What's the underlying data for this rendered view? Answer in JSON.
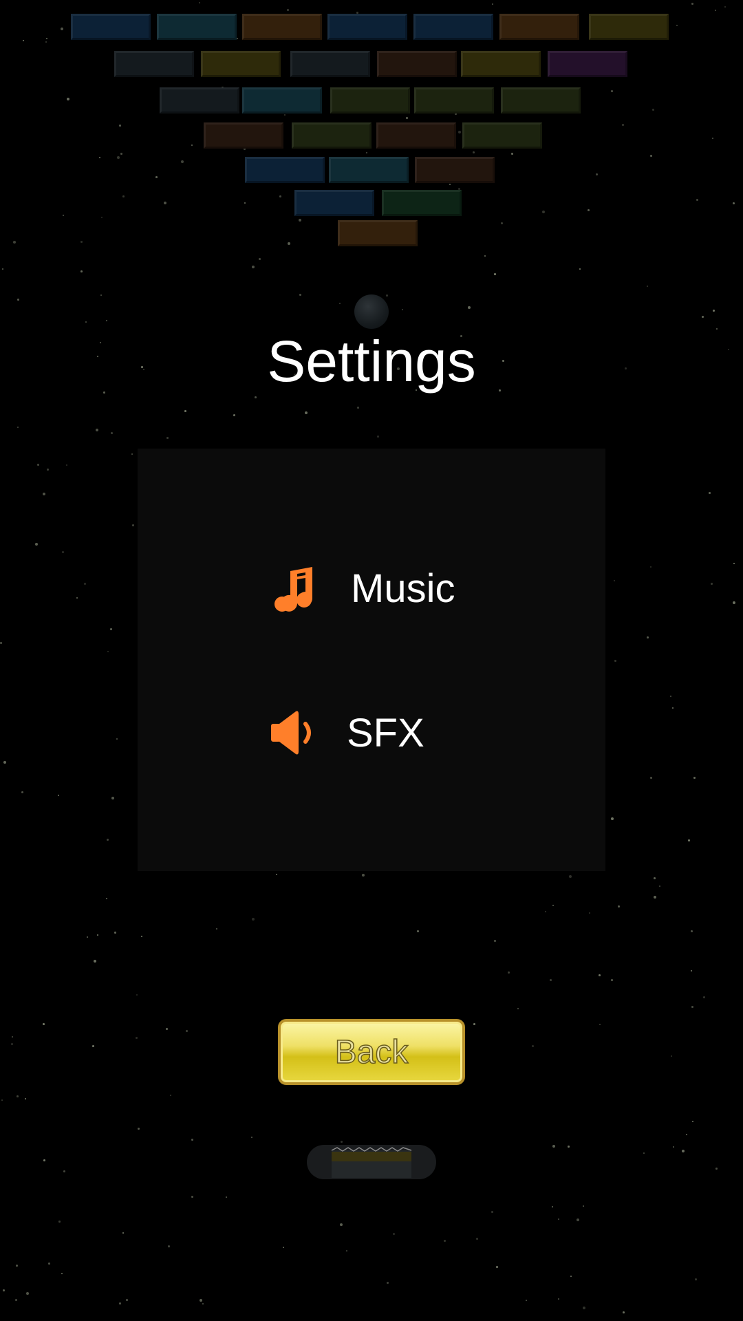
{
  "screen": {
    "title": "Settings",
    "options": [
      {
        "label": "Music",
        "icon": "music-note-icon",
        "color": "#ff7f2a"
      },
      {
        "label": "SFX",
        "icon": "speaker-icon",
        "color": "#ff7f2a"
      }
    ],
    "back_label": "Back"
  },
  "colors": {
    "background": "#000000",
    "panel": "#0b0b0b",
    "accent": "#ff7f2a",
    "button_fill": "#efe066",
    "button_border": "#b8912a"
  },
  "game": {
    "bricks": [
      [
        "blue",
        "cyan",
        "orange",
        "blue",
        "blue",
        "orange",
        "yellow"
      ],
      [
        "gray",
        "yellow",
        "gray",
        "brown",
        "yellow",
        "purple"
      ],
      [
        "gray",
        "cyan",
        "olive",
        "olive",
        "olive"
      ],
      [
        "brown",
        "olive",
        "brown",
        "olive"
      ],
      [
        "blue",
        "cyan",
        "brown"
      ],
      [
        "blue",
        "green"
      ],
      [
        "orange"
      ]
    ]
  }
}
